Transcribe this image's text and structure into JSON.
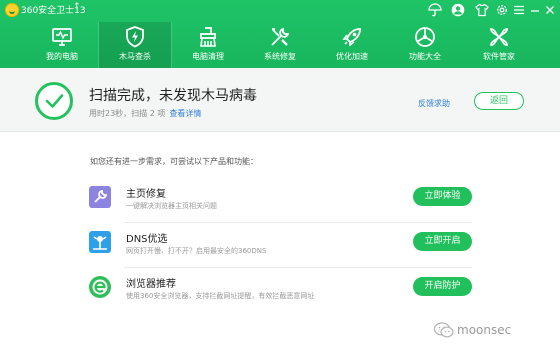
{
  "app": {
    "title": "360安全卫士13",
    "up_arrow": "↑",
    "brand_color": "#1fc467"
  },
  "titlebar_icons": [
    "umbrella-icon",
    "shirt-icon",
    "user-icon",
    "settings-icon",
    "menu-icon",
    "minimize-icon",
    "close-icon"
  ],
  "nav": {
    "items": [
      {
        "label": "我的电脑",
        "icon": "monitor-icon",
        "active": false
      },
      {
        "label": "木马查杀",
        "icon": "shield-icon",
        "active": true
      },
      {
        "label": "电脑清理",
        "icon": "broom-icon",
        "active": false
      },
      {
        "label": "系统修复",
        "icon": "tools-icon",
        "active": false
      },
      {
        "label": "优化加速",
        "icon": "rocket-icon",
        "active": false
      },
      {
        "label": "功能大全",
        "icon": "apps-icon",
        "active": false
      },
      {
        "label": "软件管家",
        "icon": "software-icon",
        "active": false
      }
    ]
  },
  "result": {
    "title": "扫描完成，未发现木马病毒",
    "subtitle": "用时23秒，扫描 2 项",
    "details_link": "查看详情",
    "feedback_link": "反馈求助",
    "return_button": "返回"
  },
  "suggestions": {
    "hint": "如您还有进一步需求，可尝试以下产品和功能：",
    "items": [
      {
        "title": "主页修复",
        "desc": "一键解决浏览器主页相关问题",
        "button": "立即体验",
        "icon": "homepage-repair-icon"
      },
      {
        "title": "DNS优选",
        "desc": "网页打开慢、打不开？启用最安全的360DNS",
        "button": "立即开启",
        "icon": "dns-icon"
      },
      {
        "title": "浏览器推荐",
        "desc": "使用360安全浏览器，支持拦截网址提醒，有效拦截恶意网址",
        "button": "开启防护",
        "icon": "browser-icon"
      }
    ]
  },
  "watermark": "moonsec"
}
